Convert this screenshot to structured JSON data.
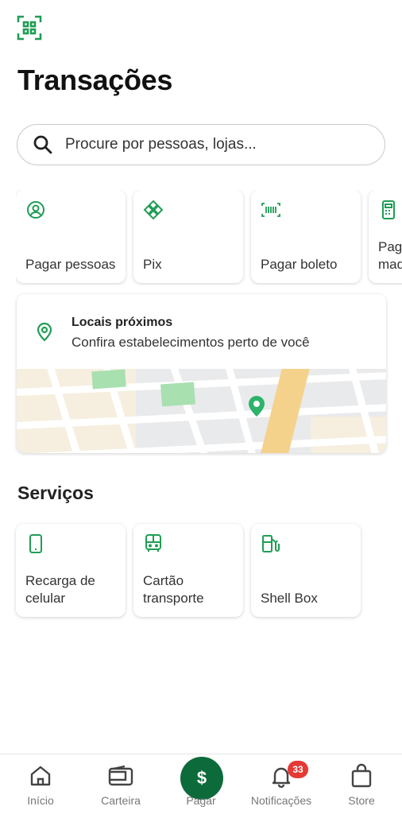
{
  "header": {
    "title": "Transações"
  },
  "search": {
    "placeholder": "Procure por pessoas, lojas..."
  },
  "quick_actions": [
    {
      "label": "Pagar pessoas",
      "icon": "user-circle-icon"
    },
    {
      "label": "Pix",
      "icon": "pix-icon"
    },
    {
      "label": "Pagar boleto",
      "icon": "barcode-icon"
    },
    {
      "label": "Pagar maquininha",
      "icon": "card-machine-icon"
    }
  ],
  "nearby": {
    "title": "Locais próximos",
    "subtitle": "Confira estabelecimentos perto de você"
  },
  "services": {
    "title": "Serviços",
    "items": [
      {
        "label": "Recarga de celular",
        "icon": "phone-icon"
      },
      {
        "label": "Cartão transporte",
        "icon": "bus-icon"
      },
      {
        "label": "Shell Box",
        "icon": "fuel-pump-icon"
      }
    ]
  },
  "bottom_nav": {
    "items": [
      {
        "label": "Início",
        "icon": "home-icon"
      },
      {
        "label": "Carteira",
        "icon": "wallet-icon"
      },
      {
        "label": "Pagar",
        "icon": "dollar-icon",
        "glyph": "$"
      },
      {
        "label": "Notificações",
        "icon": "bell-icon"
      },
      {
        "label": "Store",
        "icon": "shopping-bag-icon"
      }
    ],
    "notification_count": "33"
  },
  "colors": {
    "accent": "#1f9d55",
    "pay_button": "#0d6b3b",
    "badge": "#e53935"
  }
}
